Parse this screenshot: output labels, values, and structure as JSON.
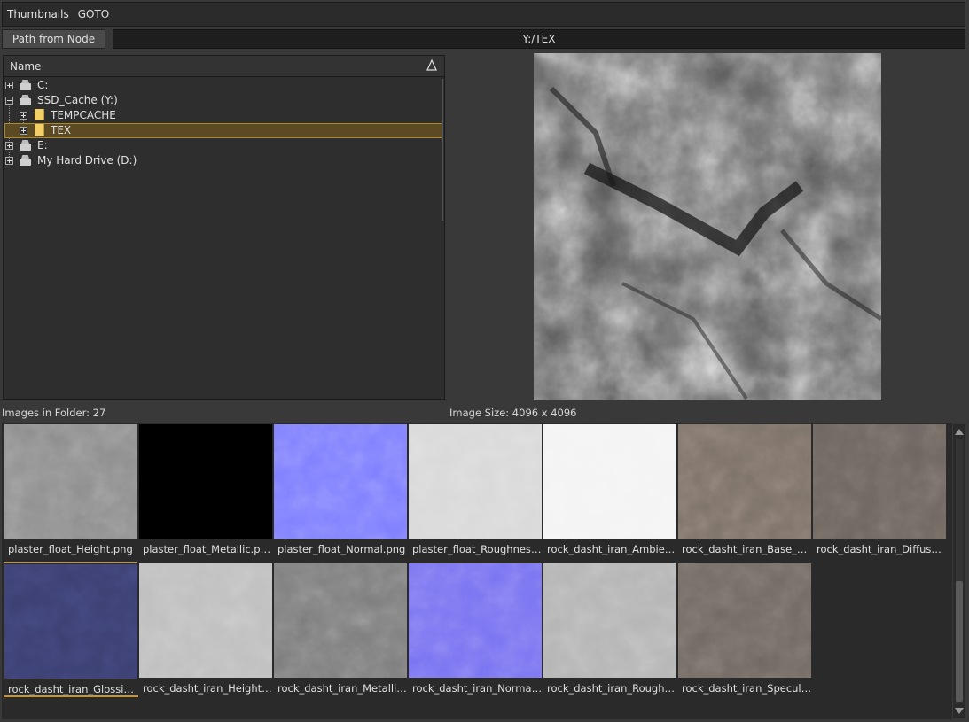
{
  "menu": {
    "items": [
      "Thumbnails",
      "GOTO"
    ]
  },
  "path_button": "Path from Node",
  "path_value": "Y:/TEX",
  "tree": {
    "header": "Name",
    "rows": [
      {
        "label": "C:",
        "icon": "drive-icon"
      },
      {
        "label": "SSD_Cache (Y:)",
        "icon": "drive-icon"
      },
      {
        "label": "TEMPCACHE",
        "icon": "folder-icon"
      },
      {
        "label": "TEX",
        "icon": "folder-icon"
      },
      {
        "label": "E:",
        "icon": "drive-icon"
      },
      {
        "label": "My Hard Drive (D:)",
        "icon": "drive-icon"
      }
    ]
  },
  "status": {
    "images_in_folder": "Images in Folder: 27",
    "image_size": "Image Size: 4096 x 4096"
  },
  "thumbnails": [
    {
      "name": "plaster_float_Height.png",
      "color": "#8f8f8f"
    },
    {
      "name": "plaster_float_Metallic.png",
      "color": "#000000"
    },
    {
      "name": "plaster_float_Normal.png",
      "color": "#8080ff"
    },
    {
      "name": "plaster_float_Roughness.png",
      "color": "#d9d9d9"
    },
    {
      "name": "rock_dasht_iran_Ambient_Occlusion.png",
      "color": "#f4f4f4"
    },
    {
      "name": "rock_dasht_iran_Base_Color.png",
      "color": "#7d7269"
    },
    {
      "name": "rock_dasht_iran_Diffuse.png",
      "color": "#6e6660"
    },
    {
      "name": "rock_dasht_iran_Glossiness.png",
      "color": "#3b3f70"
    },
    {
      "name": "rock_dasht_iran_Height.png",
      "color": "#bfbfbf"
    },
    {
      "name": "rock_dasht_iran_Metallic.png",
      "color": "#7f7f7f"
    },
    {
      "name": "rock_dasht_iran_Normal.png",
      "color": "#7a74f2"
    },
    {
      "name": "rock_dasht_iran_Roughness.png",
      "color": "#b5b5b5"
    },
    {
      "name": "rock_dasht_iran_Specular.png",
      "color": "#726a64"
    }
  ]
}
